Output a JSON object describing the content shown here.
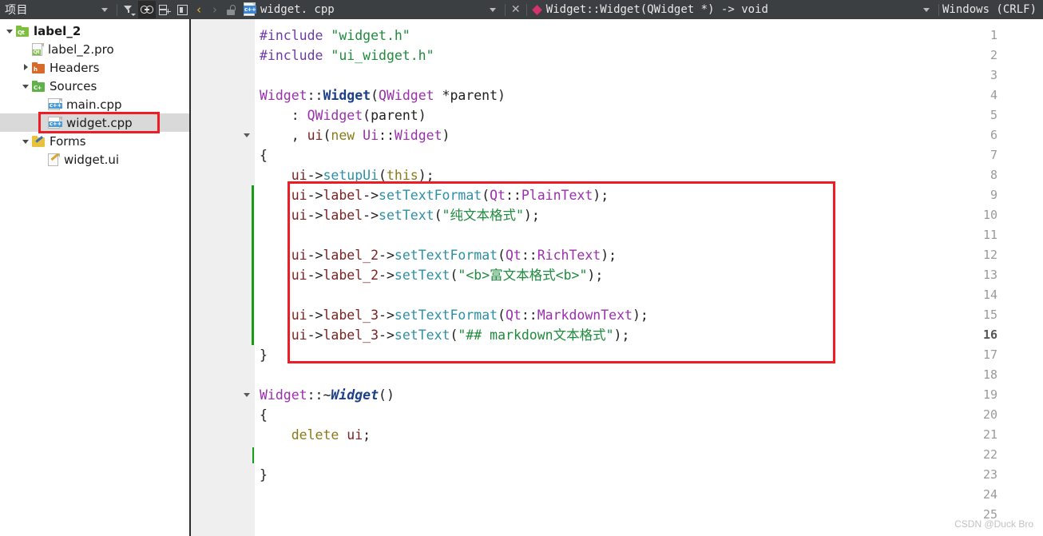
{
  "topbar": {
    "project_label": "项目",
    "icons": [
      {
        "name": "chevron-down-icon",
        "label": "▾"
      },
      {
        "name": "filter-icon",
        "label": "filter"
      },
      {
        "name": "link-icon",
        "label": "link",
        "active": true
      },
      {
        "name": "split-add-icon",
        "label": "add-split"
      },
      {
        "name": "panel-toggle-icon",
        "label": "panel"
      }
    ],
    "nav": {
      "back": "‹",
      "forward": "›"
    },
    "lock_icon": "unlocked-padlock",
    "file_icon_badge": "c++",
    "open_file": "widget. cpp",
    "file_dropdown": "▾",
    "close_label": "✕",
    "symbol_marker": "diamond",
    "symbol": "Widget::Widget(QWidget *) -> void",
    "symbol_dropdown": "▾",
    "line_ending": "Windows (CRLF)"
  },
  "sidebar": {
    "items": [
      {
        "label": "label_2",
        "icon": "qt-project-folder-icon",
        "twisty": "down",
        "indent": 0,
        "bold": true,
        "selected": false
      },
      {
        "label": "label_2.pro",
        "icon": "pro-file-icon",
        "twisty": "none",
        "indent": 1,
        "bold": false,
        "selected": false
      },
      {
        "label": "Headers",
        "icon": "headers-folder-icon",
        "twisty": "right",
        "indent": 1,
        "bold": false,
        "selected": false
      },
      {
        "label": "Sources",
        "icon": "sources-folder-icon",
        "twisty": "down",
        "indent": 1,
        "bold": false,
        "selected": false
      },
      {
        "label": "main.cpp",
        "icon": "cpp-file-icon",
        "twisty": "none",
        "indent": 2,
        "bold": false,
        "selected": false
      },
      {
        "label": "widget.cpp",
        "icon": "cpp-file-icon",
        "twisty": "none",
        "indent": 2,
        "bold": false,
        "selected": true
      },
      {
        "label": "Forms",
        "icon": "forms-folder-icon",
        "twisty": "down",
        "indent": 1,
        "bold": false,
        "selected": false
      },
      {
        "label": "widget.ui",
        "icon": "ui-file-icon",
        "twisty": "none",
        "indent": 2,
        "bold": false,
        "selected": false
      }
    ]
  },
  "editor": {
    "current_line": 16,
    "first_line": 1,
    "last_line": 25,
    "modified_range": {
      "from": 9,
      "to": 16
    },
    "fold_markers": [
      6,
      19
    ],
    "lines": [
      {
        "n": 1,
        "tokens": [
          {
            "t": "#include ",
            "c": "t-pre"
          },
          {
            "t": "\"widget.h\"",
            "c": "t-str"
          }
        ]
      },
      {
        "n": 2,
        "tokens": [
          {
            "t": "#include ",
            "c": "t-pre"
          },
          {
            "t": "\"ui_widget.h\"",
            "c": "t-str"
          }
        ]
      },
      {
        "n": 3,
        "tokens": []
      },
      {
        "n": 4,
        "tokens": [
          {
            "t": "Widget",
            "c": "t-cls"
          },
          {
            "t": "::",
            "c": "t-pl"
          },
          {
            "t": "Widget",
            "c": "t-ctor"
          },
          {
            "t": "(",
            "c": "t-pl"
          },
          {
            "t": "QWidget",
            "c": "t-cls"
          },
          {
            "t": " *parent)",
            "c": "t-pl"
          }
        ]
      },
      {
        "n": 5,
        "tokens": [
          {
            "t": "    : ",
            "c": "t-pl"
          },
          {
            "t": "QWidget",
            "c": "t-cls"
          },
          {
            "t": "(parent)",
            "c": "t-pl"
          }
        ]
      },
      {
        "n": 6,
        "tokens": [
          {
            "t": "    , ",
            "c": "t-pl"
          },
          {
            "t": "ui",
            "c": "t-var"
          },
          {
            "t": "(",
            "c": "t-pl"
          },
          {
            "t": "new",
            "c": "t-kw"
          },
          {
            "t": " ",
            "c": "t-pl"
          },
          {
            "t": "Ui",
            "c": "t-cls"
          },
          {
            "t": "::",
            "c": "t-pl"
          },
          {
            "t": "Widget",
            "c": "t-cls"
          },
          {
            "t": ")",
            "c": "t-pl"
          }
        ]
      },
      {
        "n": 7,
        "tokens": [
          {
            "t": "{",
            "c": "t-pl"
          }
        ]
      },
      {
        "n": 8,
        "tokens": [
          {
            "t": "    ",
            "c": "t-pl"
          },
          {
            "t": "ui",
            "c": "t-var"
          },
          {
            "t": "->",
            "c": "t-pl"
          },
          {
            "t": "setupUi",
            "c": "t-fn"
          },
          {
            "t": "(",
            "c": "t-pl"
          },
          {
            "t": "this",
            "c": "t-kw"
          },
          {
            "t": ");",
            "c": "t-pl"
          }
        ]
      },
      {
        "n": 9,
        "tokens": [
          {
            "t": "    ",
            "c": "t-pl"
          },
          {
            "t": "ui",
            "c": "t-var"
          },
          {
            "t": "->",
            "c": "t-pl"
          },
          {
            "t": "label",
            "c": "t-var"
          },
          {
            "t": "->",
            "c": "t-pl"
          },
          {
            "t": "setTextFormat",
            "c": "t-fn"
          },
          {
            "t": "(",
            "c": "t-pl"
          },
          {
            "t": "Qt",
            "c": "t-cls"
          },
          {
            "t": "::",
            "c": "t-pl"
          },
          {
            "t": "PlainText",
            "c": "t-en"
          },
          {
            "t": ");",
            "c": "t-pl"
          }
        ]
      },
      {
        "n": 10,
        "tokens": [
          {
            "t": "    ",
            "c": "t-pl"
          },
          {
            "t": "ui",
            "c": "t-var"
          },
          {
            "t": "->",
            "c": "t-pl"
          },
          {
            "t": "label",
            "c": "t-var"
          },
          {
            "t": "->",
            "c": "t-pl"
          },
          {
            "t": "setText",
            "c": "t-fn"
          },
          {
            "t": "(",
            "c": "t-pl"
          },
          {
            "t": "\"纯文本格式\"",
            "c": "t-str"
          },
          {
            "t": ");",
            "c": "t-pl"
          }
        ]
      },
      {
        "n": 11,
        "tokens": []
      },
      {
        "n": 12,
        "tokens": [
          {
            "t": "    ",
            "c": "t-pl"
          },
          {
            "t": "ui",
            "c": "t-var"
          },
          {
            "t": "->",
            "c": "t-pl"
          },
          {
            "t": "label_2",
            "c": "t-var"
          },
          {
            "t": "->",
            "c": "t-pl"
          },
          {
            "t": "setTextFormat",
            "c": "t-fn"
          },
          {
            "t": "(",
            "c": "t-pl"
          },
          {
            "t": "Qt",
            "c": "t-cls"
          },
          {
            "t": "::",
            "c": "t-pl"
          },
          {
            "t": "RichText",
            "c": "t-en"
          },
          {
            "t": ");",
            "c": "t-pl"
          }
        ]
      },
      {
        "n": 13,
        "tokens": [
          {
            "t": "    ",
            "c": "t-pl"
          },
          {
            "t": "ui",
            "c": "t-var"
          },
          {
            "t": "->",
            "c": "t-pl"
          },
          {
            "t": "label_2",
            "c": "t-var"
          },
          {
            "t": "->",
            "c": "t-pl"
          },
          {
            "t": "setText",
            "c": "t-fn"
          },
          {
            "t": "(",
            "c": "t-pl"
          },
          {
            "t": "\"<b>富文本格式<b>\"",
            "c": "t-str"
          },
          {
            "t": ");",
            "c": "t-pl"
          }
        ]
      },
      {
        "n": 14,
        "tokens": []
      },
      {
        "n": 15,
        "tokens": [
          {
            "t": "    ",
            "c": "t-pl"
          },
          {
            "t": "ui",
            "c": "t-var"
          },
          {
            "t": "->",
            "c": "t-pl"
          },
          {
            "t": "label_3",
            "c": "t-var"
          },
          {
            "t": "->",
            "c": "t-pl"
          },
          {
            "t": "setTextFormat",
            "c": "t-fn"
          },
          {
            "t": "(",
            "c": "t-pl"
          },
          {
            "t": "Qt",
            "c": "t-cls"
          },
          {
            "t": "::",
            "c": "t-pl"
          },
          {
            "t": "MarkdownText",
            "c": "t-en"
          },
          {
            "t": ");",
            "c": "t-pl"
          }
        ]
      },
      {
        "n": 16,
        "tokens": [
          {
            "t": "    ",
            "c": "t-pl"
          },
          {
            "t": "ui",
            "c": "t-var"
          },
          {
            "t": "->",
            "c": "t-pl"
          },
          {
            "t": "label_3",
            "c": "t-var"
          },
          {
            "t": "->",
            "c": "t-pl"
          },
          {
            "t": "setText",
            "c": "t-fn"
          },
          {
            "t": "(",
            "c": "t-pl"
          },
          {
            "t": "\"## markdown文本格式\"",
            "c": "t-str"
          },
          {
            "t": ");",
            "c": "t-pl"
          }
        ]
      },
      {
        "n": 17,
        "tokens": [
          {
            "t": "}",
            "c": "t-pl"
          }
        ]
      },
      {
        "n": 18,
        "tokens": []
      },
      {
        "n": 19,
        "tokens": [
          {
            "t": "Widget",
            "c": "t-cls"
          },
          {
            "t": "::~",
            "c": "t-pl"
          },
          {
            "t": "Widget",
            "c": "t-dtor"
          },
          {
            "t": "()",
            "c": "t-pl"
          }
        ]
      },
      {
        "n": 20,
        "tokens": [
          {
            "t": "{",
            "c": "t-pl"
          }
        ]
      },
      {
        "n": 21,
        "tokens": [
          {
            "t": "    ",
            "c": "t-pl"
          },
          {
            "t": "delete",
            "c": "t-kw"
          },
          {
            "t": " ",
            "c": "t-pl"
          },
          {
            "t": "ui",
            "c": "t-var"
          },
          {
            "t": ";",
            "c": "t-pl"
          }
        ]
      },
      {
        "n": 22,
        "tokens": []
      },
      {
        "n": 23,
        "tokens": [
          {
            "t": "}",
            "c": "t-pl"
          }
        ]
      },
      {
        "n": 24,
        "tokens": []
      },
      {
        "n": 25,
        "tokens": []
      }
    ]
  },
  "annotations": {
    "code_highlight_box_color": "#ee1c25",
    "sidebar_highlight_box_color": "#ee1c25"
  },
  "watermark": "CSDN @Duck Bro"
}
